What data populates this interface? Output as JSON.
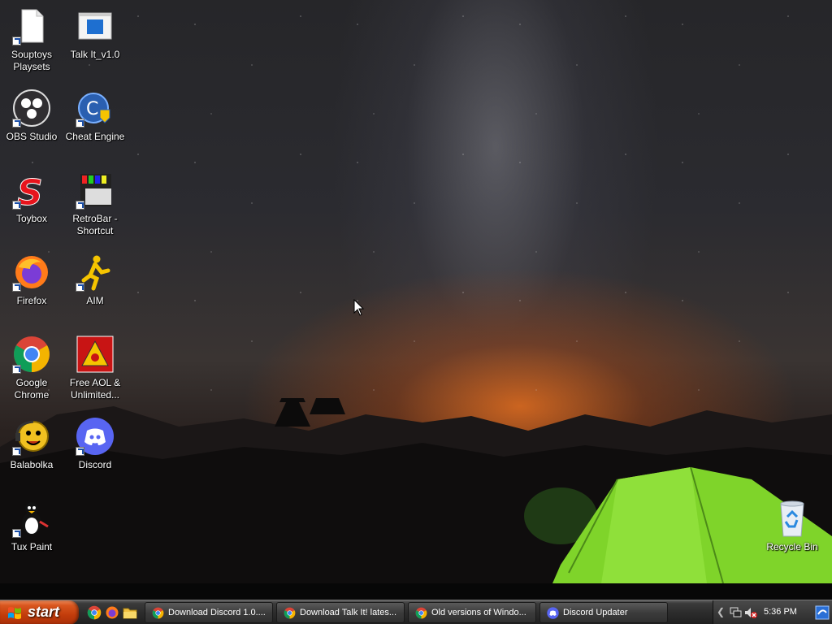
{
  "desktop": {
    "icons": [
      {
        "label": "Souptoys\nPlaysets",
        "icon": "document-icon"
      },
      {
        "label": "Talk It_v1.0",
        "icon": "window-app-icon"
      },
      {
        "label": "OBS Studio",
        "icon": "obs-icon"
      },
      {
        "label": "Cheat Engine",
        "icon": "cheat-engine-icon"
      },
      {
        "label": "Toybox",
        "icon": "toybox-icon"
      },
      {
        "label": "RetroBar -\nShortcut",
        "icon": "retrobar-icon"
      },
      {
        "label": "Firefox",
        "icon": "firefox-icon"
      },
      {
        "label": "AIM",
        "icon": "aim-icon"
      },
      {
        "label": "Google\nChrome",
        "icon": "chrome-icon"
      },
      {
        "label": "Free AOL &\nUnlimited...",
        "icon": "aol-icon"
      },
      {
        "label": "Balabolka",
        "icon": "balabolka-icon"
      },
      {
        "label": "Discord",
        "icon": "discord-icon"
      },
      {
        "label": "Tux Paint",
        "icon": "tux-paint-icon"
      },
      {
        "label": "Recycle Bin",
        "icon": "recycle-bin-icon"
      }
    ]
  },
  "taskbar": {
    "start_label": "start",
    "quick_launch": [
      "chrome-icon",
      "firefox-icon",
      "folder-icon"
    ],
    "tasks": [
      {
        "label": "Download Discord 1.0....",
        "icon": "chrome-icon"
      },
      {
        "label": "Download Talk It! lates...",
        "icon": "chrome-icon"
      },
      {
        "label": "Old versions of Windo...",
        "icon": "chrome-icon"
      },
      {
        "label": "Discord Updater",
        "icon": "discord-icon"
      }
    ],
    "tray": {
      "clock": "5:36 PM",
      "icons": [
        "chevron-left-icon",
        "network-disconnected-icon",
        "volume-muted-icon",
        "action-center-icon"
      ]
    }
  },
  "colors": {
    "start_button": "#c23c0b",
    "taskbar": "#2c2c2c",
    "tent": "#7fd42a",
    "horizon_glow": "#e06e1e"
  }
}
